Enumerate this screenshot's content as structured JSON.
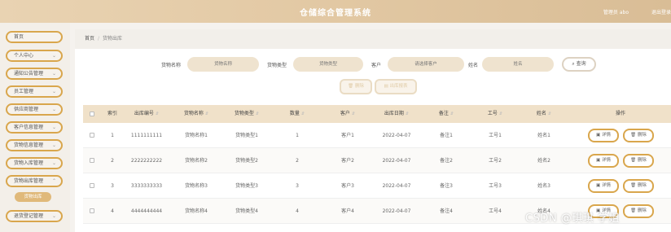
{
  "header": {
    "title": "仓储综合管理系统",
    "user": "管理员 abo",
    "logout": "退出登录"
  },
  "sidebar": {
    "items": [
      {
        "label": "首页"
      },
      {
        "label": "个人中心"
      },
      {
        "label": "通知公告管理"
      },
      {
        "label": "员工管理"
      },
      {
        "label": "供应商管理"
      },
      {
        "label": "客户信息管理"
      },
      {
        "label": "货物信息管理"
      },
      {
        "label": "货物入库管理"
      },
      {
        "label": "货物出库管理"
      },
      {
        "label": "退货登记管理"
      }
    ],
    "active_sub": "货物出库"
  },
  "breadcrumb": {
    "home": "首页",
    "sep": "/",
    "current": "货物出库"
  },
  "search": {
    "fields": [
      {
        "label": "货物名称",
        "placeholder": "货物名称"
      },
      {
        "label": "货物类型",
        "placeholder": "货物类型"
      },
      {
        "label": "客户",
        "placeholder": "请选择客户"
      },
      {
        "label": "姓名",
        "placeholder": "姓名"
      }
    ],
    "button": "查询"
  },
  "actions": {
    "delete": "删除",
    "report": "出库报表"
  },
  "table": {
    "headers": [
      "索引",
      "出库编号",
      "货物名称",
      "货物类型",
      "数量",
      "客户",
      "出库日期",
      "备注",
      "工号",
      "姓名",
      "操作"
    ],
    "rows": [
      {
        "index": "1",
        "code": "1111111111",
        "name": "货物名称1",
        "type": "货物类型1",
        "qty": "1",
        "customer": "客户1",
        "date": "2022-04-07",
        "remark": "备注1",
        "staff_no": "工号1",
        "staff_name": "姓名1"
      },
      {
        "index": "2",
        "code": "2222222222",
        "name": "货物名称2",
        "type": "货物类型2",
        "qty": "2",
        "customer": "客户2",
        "date": "2022-04-07",
        "remark": "备注2",
        "staff_no": "工号2",
        "staff_name": "姓名2"
      },
      {
        "index": "3",
        "code": "3333333333",
        "name": "货物名称3",
        "type": "货物类型3",
        "qty": "3",
        "customer": "客户3",
        "date": "2022-04-07",
        "remark": "备注3",
        "staff_no": "工号3",
        "staff_name": "姓名3"
      },
      {
        "index": "4",
        "code": "4444444444",
        "name": "货物名称4",
        "type": "货物类型4",
        "qty": "4",
        "customer": "客户4",
        "date": "2022-04-07",
        "remark": "备注4",
        "staff_no": "工号4",
        "staff_name": "姓名4"
      }
    ],
    "row_actions": {
      "detail": "详情",
      "delete": "删除"
    }
  },
  "watermark": "CSDN @琪琪 学姐",
  "colors": {
    "accent": "#d9a64c",
    "header": "#e2c8a3",
    "table_head": "#f0e1c9"
  }
}
